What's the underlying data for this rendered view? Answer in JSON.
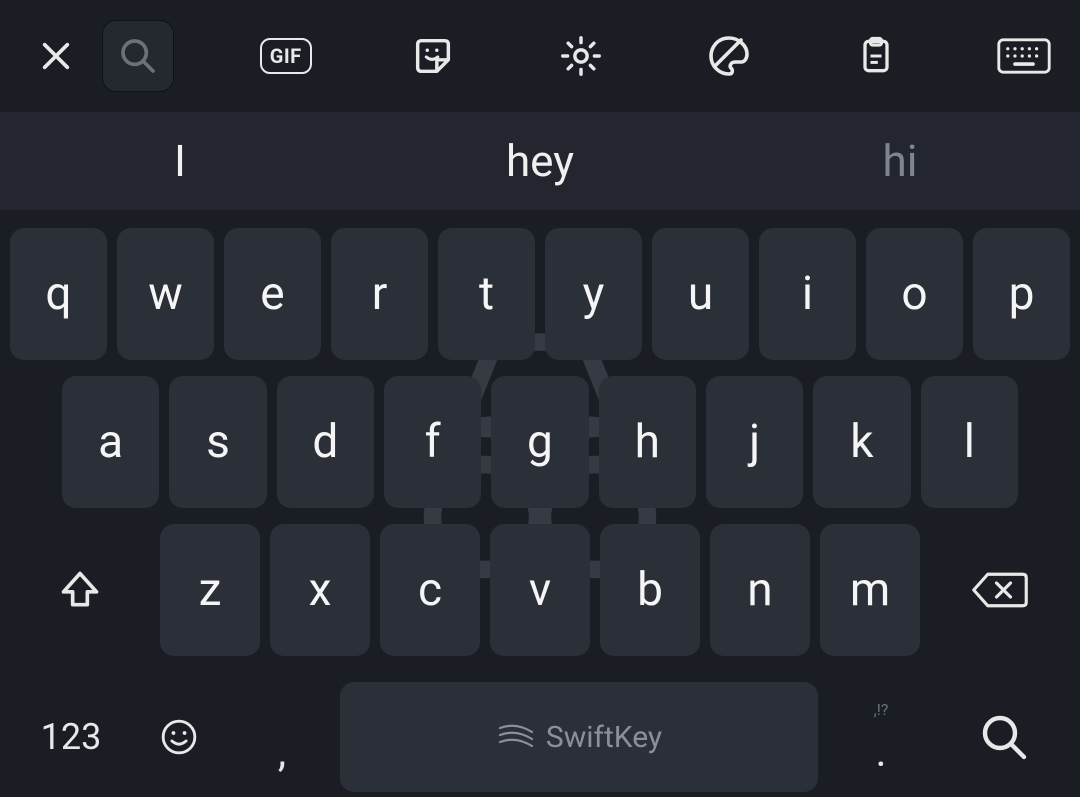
{
  "toolbar": {
    "gif_label": "GIF"
  },
  "suggestions": {
    "left": "I",
    "center": "hey",
    "right": "hi"
  },
  "rows": {
    "r1": [
      "q",
      "w",
      "e",
      "r",
      "t",
      "y",
      "u",
      "i",
      "o",
      "p"
    ],
    "r2": [
      "a",
      "s",
      "d",
      "f",
      "g",
      "h",
      "j",
      "k",
      "l"
    ],
    "r3": [
      "z",
      "x",
      "c",
      "v",
      "b",
      "n",
      "m"
    ]
  },
  "bottom": {
    "numeric_label": "123",
    "comma": ",",
    "space_label": "SwiftKey",
    "period": ".",
    "period_hint": ",!?"
  }
}
